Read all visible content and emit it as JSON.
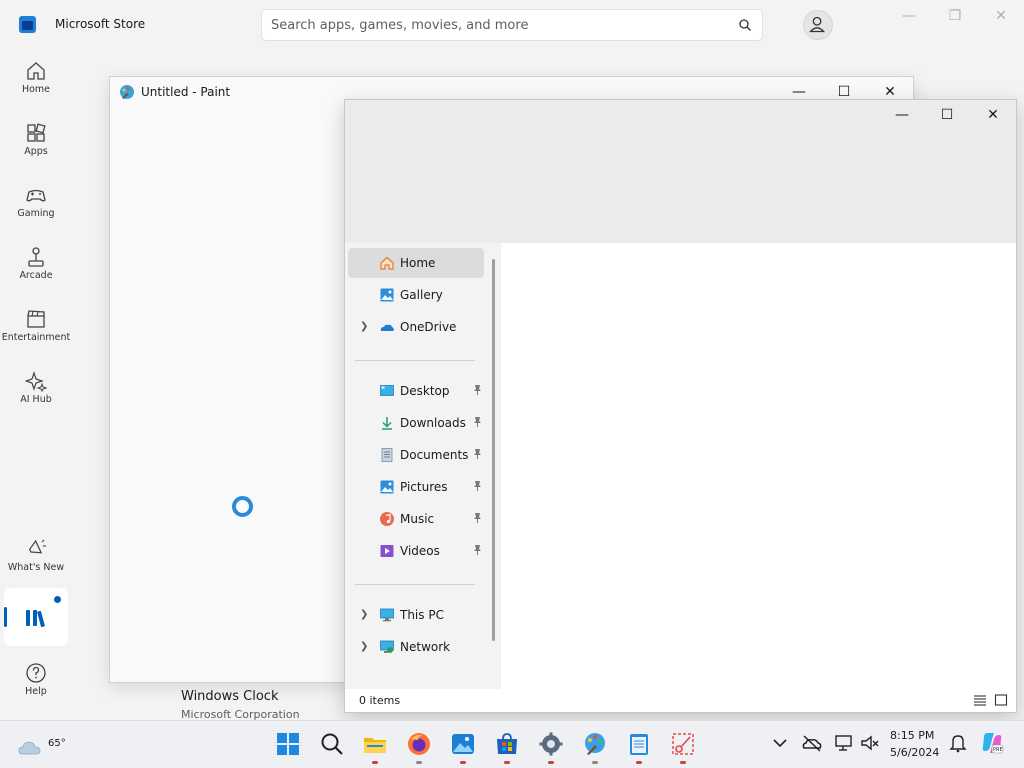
{
  "store": {
    "title": "Microsoft Store",
    "search_placeholder": "Search apps, games, movies, and more",
    "nav": [
      {
        "label": "Home"
      },
      {
        "label": "Apps"
      },
      {
        "label": "Gaming"
      },
      {
        "label": "Arcade"
      },
      {
        "label": "Entertainment"
      },
      {
        "label": "AI Hub"
      },
      {
        "label": "What's New"
      },
      {
        "label": "Help"
      }
    ],
    "card": {
      "app_name": "Windows Clock",
      "publisher": "Microsoft Corporation"
    }
  },
  "paint": {
    "title": "Untitled - Paint"
  },
  "explorer": {
    "quick": [
      {
        "label": "Home",
        "icon": "home-icon"
      },
      {
        "label": "Gallery",
        "icon": "gallery-icon"
      },
      {
        "label": "OneDrive",
        "icon": "onedrive-icon"
      }
    ],
    "pinned": [
      {
        "label": "Desktop",
        "icon": "desktop-icon"
      },
      {
        "label": "Downloads",
        "icon": "downloads-icon"
      },
      {
        "label": "Documents",
        "icon": "documents-icon"
      },
      {
        "label": "Pictures",
        "icon": "pictures-icon"
      },
      {
        "label": "Music",
        "icon": "music-icon"
      },
      {
        "label": "Videos",
        "icon": "videos-icon"
      }
    ],
    "locations": [
      {
        "label": "This PC",
        "icon": "this-pc-icon"
      },
      {
        "label": "Network",
        "icon": "network-icon"
      }
    ],
    "status": "0 items"
  },
  "taskbar": {
    "weather_temp": "65°",
    "time": "8:15 PM",
    "date": "5/6/2024"
  },
  "colors": {
    "accent": "#005fb8",
    "running_indicator": "#d14040"
  }
}
